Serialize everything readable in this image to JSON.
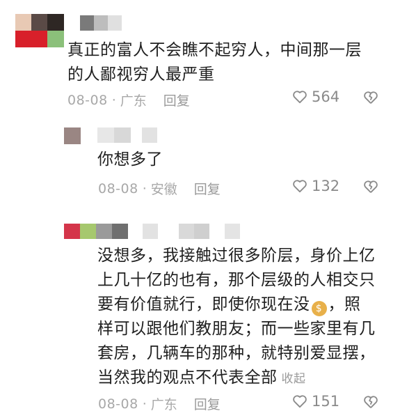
{
  "comments": [
    {
      "text": "真正的富人不会瞧不起穷人，中间那一层\n的人鄙视穷人最严重",
      "date": "08-08",
      "location": "广东",
      "reply_label": "回复",
      "likes": "564"
    },
    {
      "text": "你想多了",
      "date": "08-08",
      "location": "安徽",
      "reply_label": "回复",
      "likes": "132"
    },
    {
      "text_line1": "没想多，我接触过很多阶层，身价上亿",
      "text_line2": "上几十亿的也有，那个层级的人相交只",
      "text_line3_pre": "要有价值就行，即使你现在没",
      "text_line3_post": "，照",
      "text_line4": "样可以跟他们教朋友；而一些家里有几",
      "text_line5": "套房，几辆车的那种，就特别爱显摆，",
      "text_line6": "当然我的观点不代表全部",
      "collapse_label": "收起",
      "date": "08-08",
      "location": "广东",
      "reply_label": "回复",
      "likes": "151"
    }
  ],
  "icons": {
    "like": "heart-outline-icon",
    "dislike": "broken-heart-icon",
    "money_bag": "money-bag-emoji"
  },
  "colors": {
    "meta_text": "#a8a8a8",
    "icon_stroke": "#8a8a8a"
  }
}
